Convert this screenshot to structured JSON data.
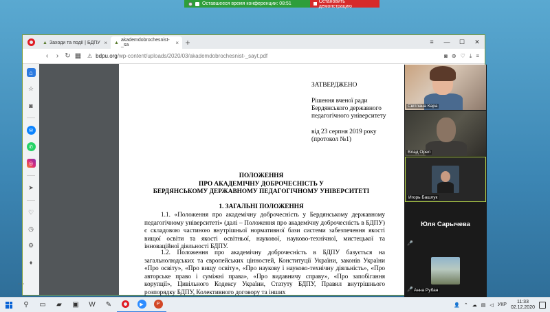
{
  "zoom": {
    "timer_label": "Оставшееся время конференции: 08:51",
    "stop_label": "Остановить демонстрацию"
  },
  "browser": {
    "tabs": [
      {
        "label": "Заходи та події | БДПУ",
        "active": false
      },
      {
        "label": "akademdobrochesnist-_sa",
        "active": true
      }
    ],
    "url_host": "bdpu.org",
    "url_path": "/wp-content/uploads/2020/03/akademdobrochesnist-_sayt.pdf"
  },
  "document": {
    "approval": {
      "head": "ЗАТВЕРДЖЕНО",
      "body": "Рішення вченої ради Бердянського державного педагогічного університету",
      "date": "від 23 серпня 2019 року (протокол №1)"
    },
    "title_line1": "ПОЛОЖЕННЯ",
    "title_line2": "ПРО АКАДЕМІЧНУ ДОБРОЧЕСНІСТЬ У",
    "title_line3": "БЕРДЯНСЬКОМУ ДЕРЖАВНОМУ ПЕДАГОГІЧНОМУ УНІВЕРСИТЕТІ",
    "section_title": "1.  ЗАГАЛЬНІ ПОЛОЖЕННЯ",
    "para1": "1.1. «Положення про академічну доброчесність у Бердянському державному педагогічному університеті» (далі – Положення про академічну доброчесність в БДПУ) є складовою частиною внутрішньої нормативної бази системи забезпечення якості вищої освіти та якості освітньої, наукової, науково-технічної, мистецької та інноваційної діяльності БДПУ.",
    "para2": "1.2. Положення про академічну доброчесність в БДПУ базується на загальнолюдських та європейських цінностей, Конституції України, законів України «Про освіту», «Про вищу освіту», «Про наукову і науково-технічну діяльність», «Про авторське право і суміжні права», «Про видавничу справу», «Про запобігання корупції», Цивільного Кодексу України, Статуту БДПУ, Правил внутрішнього розпорядку БДПУ, Колективного договору та інших"
  },
  "participants": [
    {
      "name": "Світлана Кара"
    },
    {
      "name": "Влад Орел"
    },
    {
      "name": "Игорь Башлук"
    },
    {
      "name": "Юля Сарычева"
    },
    {
      "name": "Анна Рубан"
    }
  ],
  "taskbar": {
    "language": "УКР",
    "time": "11:33",
    "date": "02.12.2020"
  }
}
